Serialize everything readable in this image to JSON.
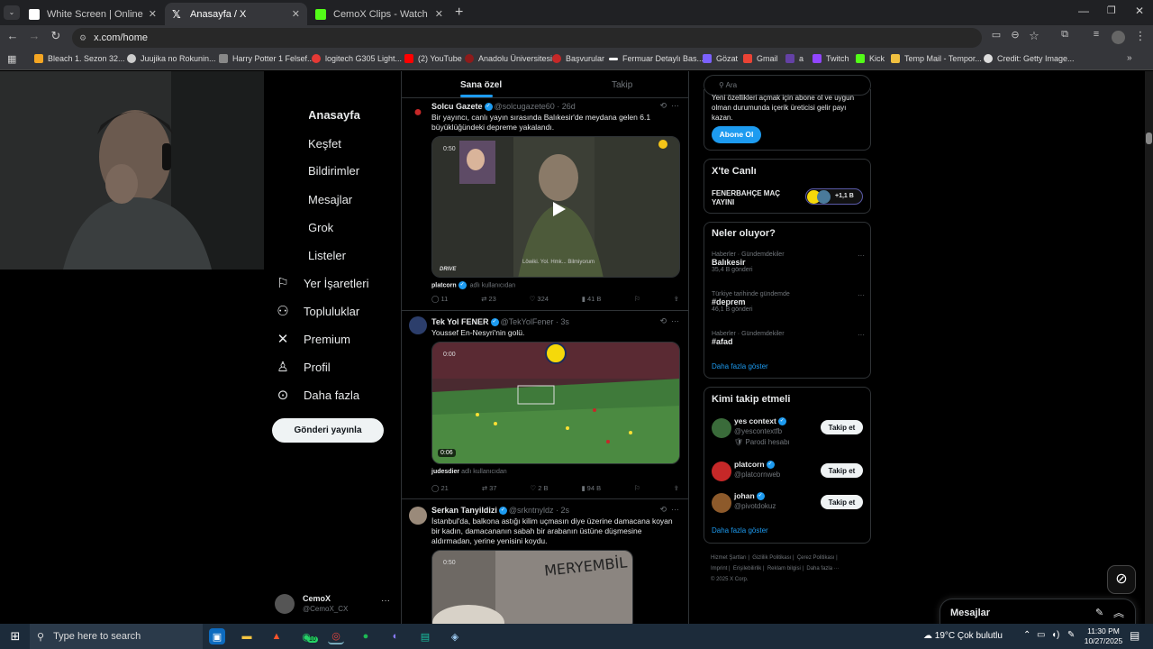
{
  "browser": {
    "tabs": [
      {
        "title": "White Screen | Online Tool",
        "active": false,
        "favicon_color": "#ffffff"
      },
      {
        "title": "Anasayfa / X",
        "active": true,
        "favicon_color": "#ffffff"
      },
      {
        "title": "CemoX Clips - Watch Live on K",
        "active": false,
        "favicon_color": "#53fc18"
      }
    ],
    "new_tab": "+",
    "url": "x.com/home",
    "bookmarks": [
      {
        "label": "Bleach 1. Sezon 32...",
        "color": "#f5a623"
      },
      {
        "label": "Juujika no Rokunin...",
        "color": "#cccccc"
      },
      {
        "label": "Harry Potter 1 Felsef...",
        "color": "#888888"
      },
      {
        "label": "logitech G305 Light...",
        "color": "#e53935"
      },
      {
        "label": "(2) YouTube",
        "color": "#ff0000"
      },
      {
        "label": "Anadolu Üniversitesi",
        "color": "#8e1b1b"
      },
      {
        "label": "Başvurular",
        "color": "#c62828"
      },
      {
        "label": "Fermuar Detaylı Bas...",
        "color": "#ffffff"
      },
      {
        "label": "Gözat",
        "color": "#7b61ff"
      },
      {
        "label": "Gmail",
        "color": "#ea4335"
      },
      {
        "label": "a",
        "color": "#6441a5"
      },
      {
        "label": "Twitch",
        "color": "#9146ff"
      },
      {
        "label": "Kick",
        "color": "#53fc18"
      },
      {
        "label": "Temp Mail - Tempor...",
        "color": "#f0c040"
      },
      {
        "label": "Credit: Getty Image...",
        "color": "#dddddd"
      }
    ]
  },
  "nav": {
    "items": [
      {
        "label": "Anasayfa",
        "icon": "home-icon"
      },
      {
        "label": "Keşfet",
        "icon": "search-icon"
      },
      {
        "label": "Bildirimler",
        "icon": "bell-icon"
      },
      {
        "label": "Mesajlar",
        "icon": "mail-icon"
      },
      {
        "label": "Grok",
        "icon": "grok-icon"
      },
      {
        "label": "Listeler",
        "icon": "list-icon"
      },
      {
        "label": "Yer İşaretleri",
        "icon": "bookmark-icon"
      },
      {
        "label": "Topluluklar",
        "icon": "people-icon"
      },
      {
        "label": "Premium",
        "icon": "x-logo-icon"
      },
      {
        "label": "Profil",
        "icon": "person-icon"
      },
      {
        "label": "Daha fazla",
        "icon": "more-circle-icon"
      }
    ],
    "post_button": "Gönderi yayınla",
    "account": {
      "name": "CemoX",
      "handle": "@CemoX_CX"
    }
  },
  "feed": {
    "tabs": [
      "Sana özel",
      "Takip"
    ],
    "tweets": [
      {
        "name": "Solcu Gazete",
        "handle": "@solcugazete60 · 26d",
        "text": "Bir yayıncı, canlı yayın sırasında Balıkesir'de meydana gelen 6.1 büyüklüğündeki depreme yakalandı.",
        "media_time": "0:50",
        "media_caption": "Löwiki. Yol. Hmk... Bilmiyorum",
        "media_brand": "DRIVE",
        "credit_user": "platcorn",
        "credit_suffix": "adlı kullanıcıdan",
        "replies": "11",
        "reposts": "23",
        "likes": "324",
        "views": "41 B"
      },
      {
        "name": "Tek Yol FENER",
        "handle": "@TekYolFener · 3s",
        "text": "Youssef En-Nesyri'nin golü.",
        "media_time": "0:06",
        "media_time_top": "0:00",
        "credit_user": "judesdier",
        "credit_suffix": "adlı kullanıcıdan",
        "replies": "21",
        "reposts": "37",
        "likes": "2 B",
        "views": "94 B"
      },
      {
        "name": "Serkan Tanyildizi",
        "handle": "@srkntnyldz · 2s",
        "text": "İstanbul'da, balkona astığı kilim uçmasın diye üzerine damacana koyan bir kadın, damacananın sabah bir arabanın üstüne düşmesine aldırmadan, yerine yenisini koydu.",
        "media_time": "0:50",
        "media_graffiti": "MERYEMBİL"
      }
    ]
  },
  "right": {
    "search_placeholder": "Ara",
    "premium_text": "Yeni özellikleri açmak için abone ol ve uygun olman durumunda içerik üreticisi gelir payı kazan.",
    "subscribe": "Abone Ol",
    "live": {
      "title": "X'te Canlı",
      "event": "FENERBAHÇE MAÇ YAYINI",
      "count": "+1,1 B"
    },
    "trends_title": "Neler oluyor?",
    "trends": [
      {
        "context": "Haberler · Gündemdekiler",
        "name": "Balıkesir",
        "posts": "35,4 B gönderi"
      },
      {
        "context": "Türkiye tarihinde gündemde",
        "name": "#deprem",
        "posts": "46,1 B gönderi"
      },
      {
        "context": "Haberler · Gündemdekiler",
        "name": "#afad",
        "posts": ""
      }
    ],
    "show_more": "Daha fazla göster",
    "who_title": "Kimi takip etmeli",
    "who": [
      {
        "name": "yes context",
        "handle": "@yescontextfb",
        "extra": "Parodi hesabı",
        "avatar_color": "#3a6b3a"
      },
      {
        "name": "platcorn",
        "handle": "@platcornweb",
        "extra": "",
        "avatar_color": "#c62828"
      },
      {
        "name": "johan",
        "handle": "@pivotdokuz",
        "extra": "",
        "avatar_color": "#8d5a2b"
      }
    ],
    "follow_label": "Takip et",
    "footer": [
      "Hizmet Şartları",
      "Gizlilik Politikası",
      "Çerez Politikası",
      "Imprint",
      "Erişilebilirlik",
      "Reklam bilgisi",
      "Daha fazla ···",
      "© 2025 X Corp."
    ],
    "messages": "Mesajlar"
  },
  "taskbar": {
    "search_placeholder": "Type here to search",
    "weather": "19°C  Çok bulutlu",
    "time": "11:30 PM",
    "date": "10/27/2025",
    "whatsapp_badge": "10"
  }
}
